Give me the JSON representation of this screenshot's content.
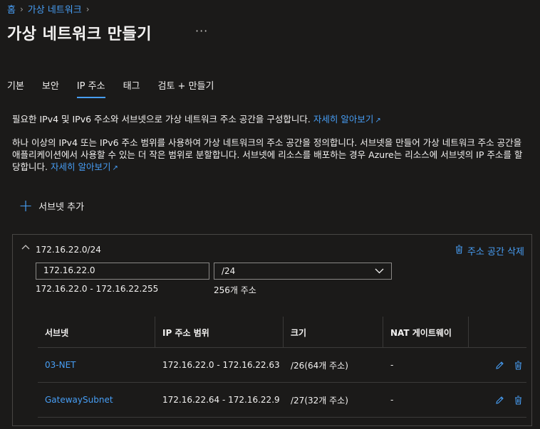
{
  "breadcrumb": {
    "home": "홈",
    "current": "가상 네트워크"
  },
  "page": {
    "title": "가상 네트워크 만들기",
    "more": "···"
  },
  "tabs": [
    {
      "label": "기본"
    },
    {
      "label": "보안"
    },
    {
      "label": "IP 주소"
    },
    {
      "label": "태그"
    },
    {
      "label": "검토 + 만들기"
    }
  ],
  "description": {
    "line1": "필요한 IPv4 및 IPv6 주소와 서브넷으로 가상 네트워크 주소 공간을 구성합니다.",
    "line1_link": "자세히 알아보기",
    "para2": "하나 이상의 IPv4 또는 IPv6 주소 범위를 사용하여 가상 네트워크의 주소 공간을 정의합니다. 서브넷을 만들어 가상 네트워크 주소 공간을 애플리케이션에서 사용할 수 있는 더 작은 범위로 분할합니다. 서브넷에 리소스를 배포하는 경우 Azure는 리소스에 서브넷의 IP 주소를 할당합니다.",
    "para2_link": "자세히 알아보기"
  },
  "add_subnet": {
    "label": "서브넷 추가"
  },
  "address_space": {
    "title": "172.16.22.0/24",
    "delete_label": "주소 공간 삭제",
    "address_value": "172.16.22.0",
    "prefix_value": "/24",
    "range_text": "172.16.22.0 - 172.16.22.255",
    "count_text": "256개 주소"
  },
  "subnet_table": {
    "headers": [
      "서브넷",
      "IP 주소 범위",
      "크기",
      "NAT 게이트웨이"
    ],
    "rows": [
      {
        "name": "03-NET",
        "range": "172.16.22.0 - 172.16.22.63",
        "size": "/26(64개 주소)",
        "nat": "-"
      },
      {
        "name": "GatewaySubnet",
        "range": "172.16.22.64 - 172.16.22.9",
        "size": "/27(32개 주소)",
        "nat": "-"
      }
    ]
  },
  "colors": {
    "accent": "#479ef5",
    "background": "#1b1a19",
    "text": "#f3f2f1"
  },
  "icons": {
    "chevron": "chevron-right-icon",
    "external": "external-link-icon",
    "plus": "plus-icon",
    "delete": "trash-icon",
    "edit": "pencil-icon",
    "collapse": "chevron-up-icon",
    "dropdown": "chevron-down-icon"
  }
}
